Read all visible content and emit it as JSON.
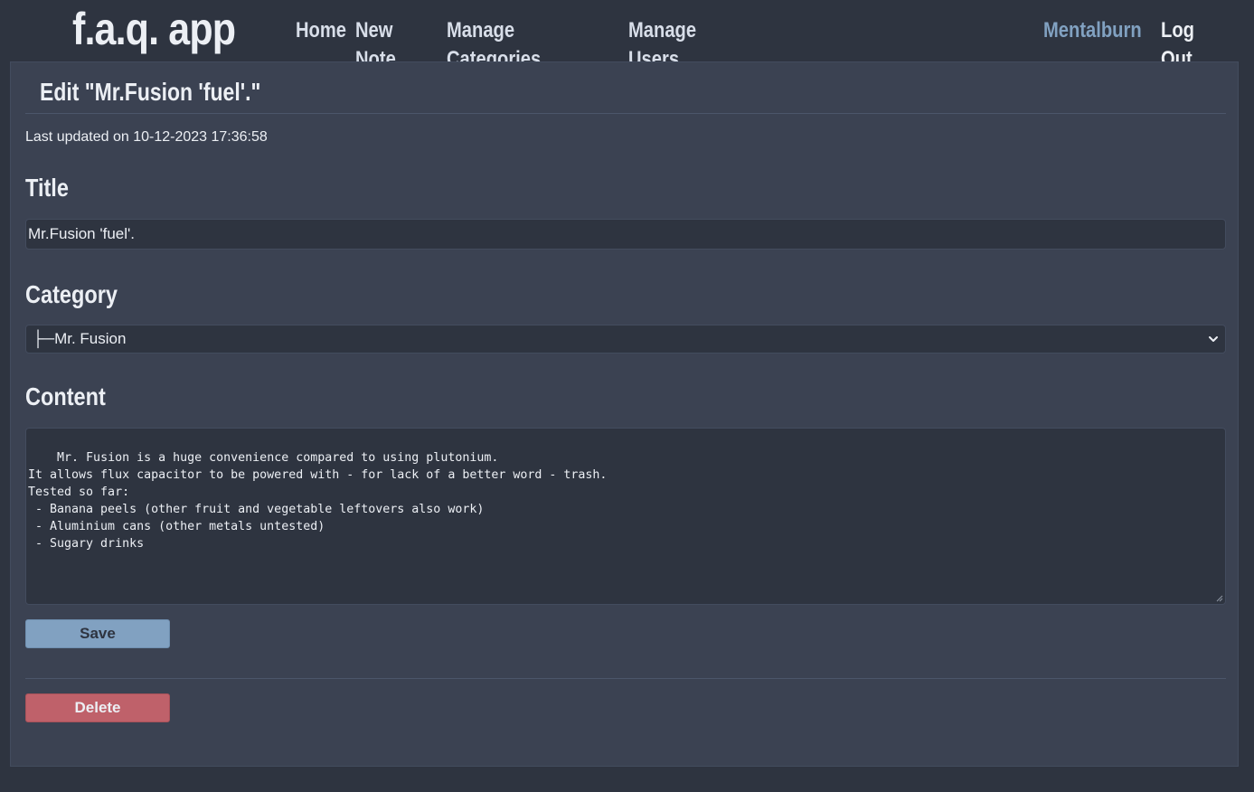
{
  "app": {
    "brand": "f.a.q. app"
  },
  "nav": {
    "home": "Home",
    "new_note": "New Note",
    "manage_categories": "Manage Categories",
    "manage_users": "Manage Users"
  },
  "user_nav": {
    "username": "Mentalburn",
    "logout": "Log Out"
  },
  "page": {
    "title": "Edit \"Mr.Fusion 'fuel'.\"",
    "last_updated": "Last updated on 10-12-2023 17:36:58"
  },
  "form": {
    "title_label": "Title",
    "title_value": "Mr.Fusion 'fuel'.",
    "category_label": "Category",
    "category_value": "├─Mr. Fusion",
    "content_label": "Content",
    "content_value": "Mr. Fusion is a huge convenience compared to using plutonium.\nIt allows flux capacitor to be powered with - for lack of a better word - trash.\nTested so far:\n - Banana peels (other fruit and vegetable leftovers also work)\n - Aluminium cans (other metals untested)\n - Sugary drinks",
    "save_label": "Save",
    "delete_label": "Delete"
  },
  "colors": {
    "background": "#2e3440",
    "panel": "#3b4252",
    "accent": "#81a1c1",
    "danger": "#bf616a"
  },
  "icons": {
    "category_select": "chevron-down-icon",
    "textarea_resize": "resize-grip-icon"
  }
}
